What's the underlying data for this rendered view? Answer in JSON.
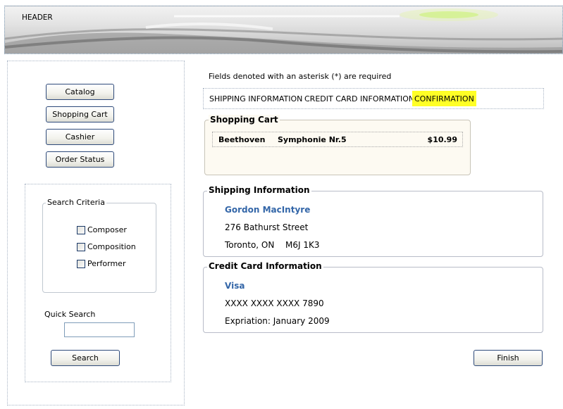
{
  "header": {
    "title": "HEADER"
  },
  "sidebar": {
    "nav": [
      {
        "label": "Catalog"
      },
      {
        "label": "Shopping Cart"
      },
      {
        "label": "Cashier"
      },
      {
        "label": "Order Status"
      }
    ],
    "search_criteria": {
      "legend": "Search Criteria",
      "options": [
        {
          "label": "Composer",
          "checked": false
        },
        {
          "label": "Composition",
          "checked": false
        },
        {
          "label": "Performer",
          "checked": false
        }
      ]
    },
    "quick_search": {
      "label": "Quick Search",
      "value": "",
      "placeholder": ""
    },
    "search_button": "Search"
  },
  "main": {
    "required_note": "Fields denoted with an asterisk (*) are required",
    "steps": [
      {
        "label": "SHIPPING INFORMATION",
        "active": false
      },
      {
        "label": "CREDIT CARD INFORMATION",
        "active": false
      },
      {
        "label": "CONFIRMATION",
        "active": true
      }
    ],
    "cart": {
      "legend": "Shopping Cart",
      "items": [
        {
          "composer": "Beethoven",
          "work": "Symphonie Nr.5",
          "price": "$10.99"
        }
      ]
    },
    "shipping": {
      "legend": "Shipping Information",
      "name": "Gordon MacIntyre",
      "street": "276 Bathurst Street",
      "city": "Toronto, ON",
      "postal": "M6J 1K3"
    },
    "credit_card": {
      "legend": "Credit Card Information",
      "type": "Visa",
      "number": "XXXX XXXX XXXX 7890",
      "expiration": "Expriation: January 2009"
    },
    "finish_button": "Finish"
  },
  "colors": {
    "active_step": "#ffff26",
    "name_link": "#3366a8",
    "button_border": "#2e4a7a"
  }
}
